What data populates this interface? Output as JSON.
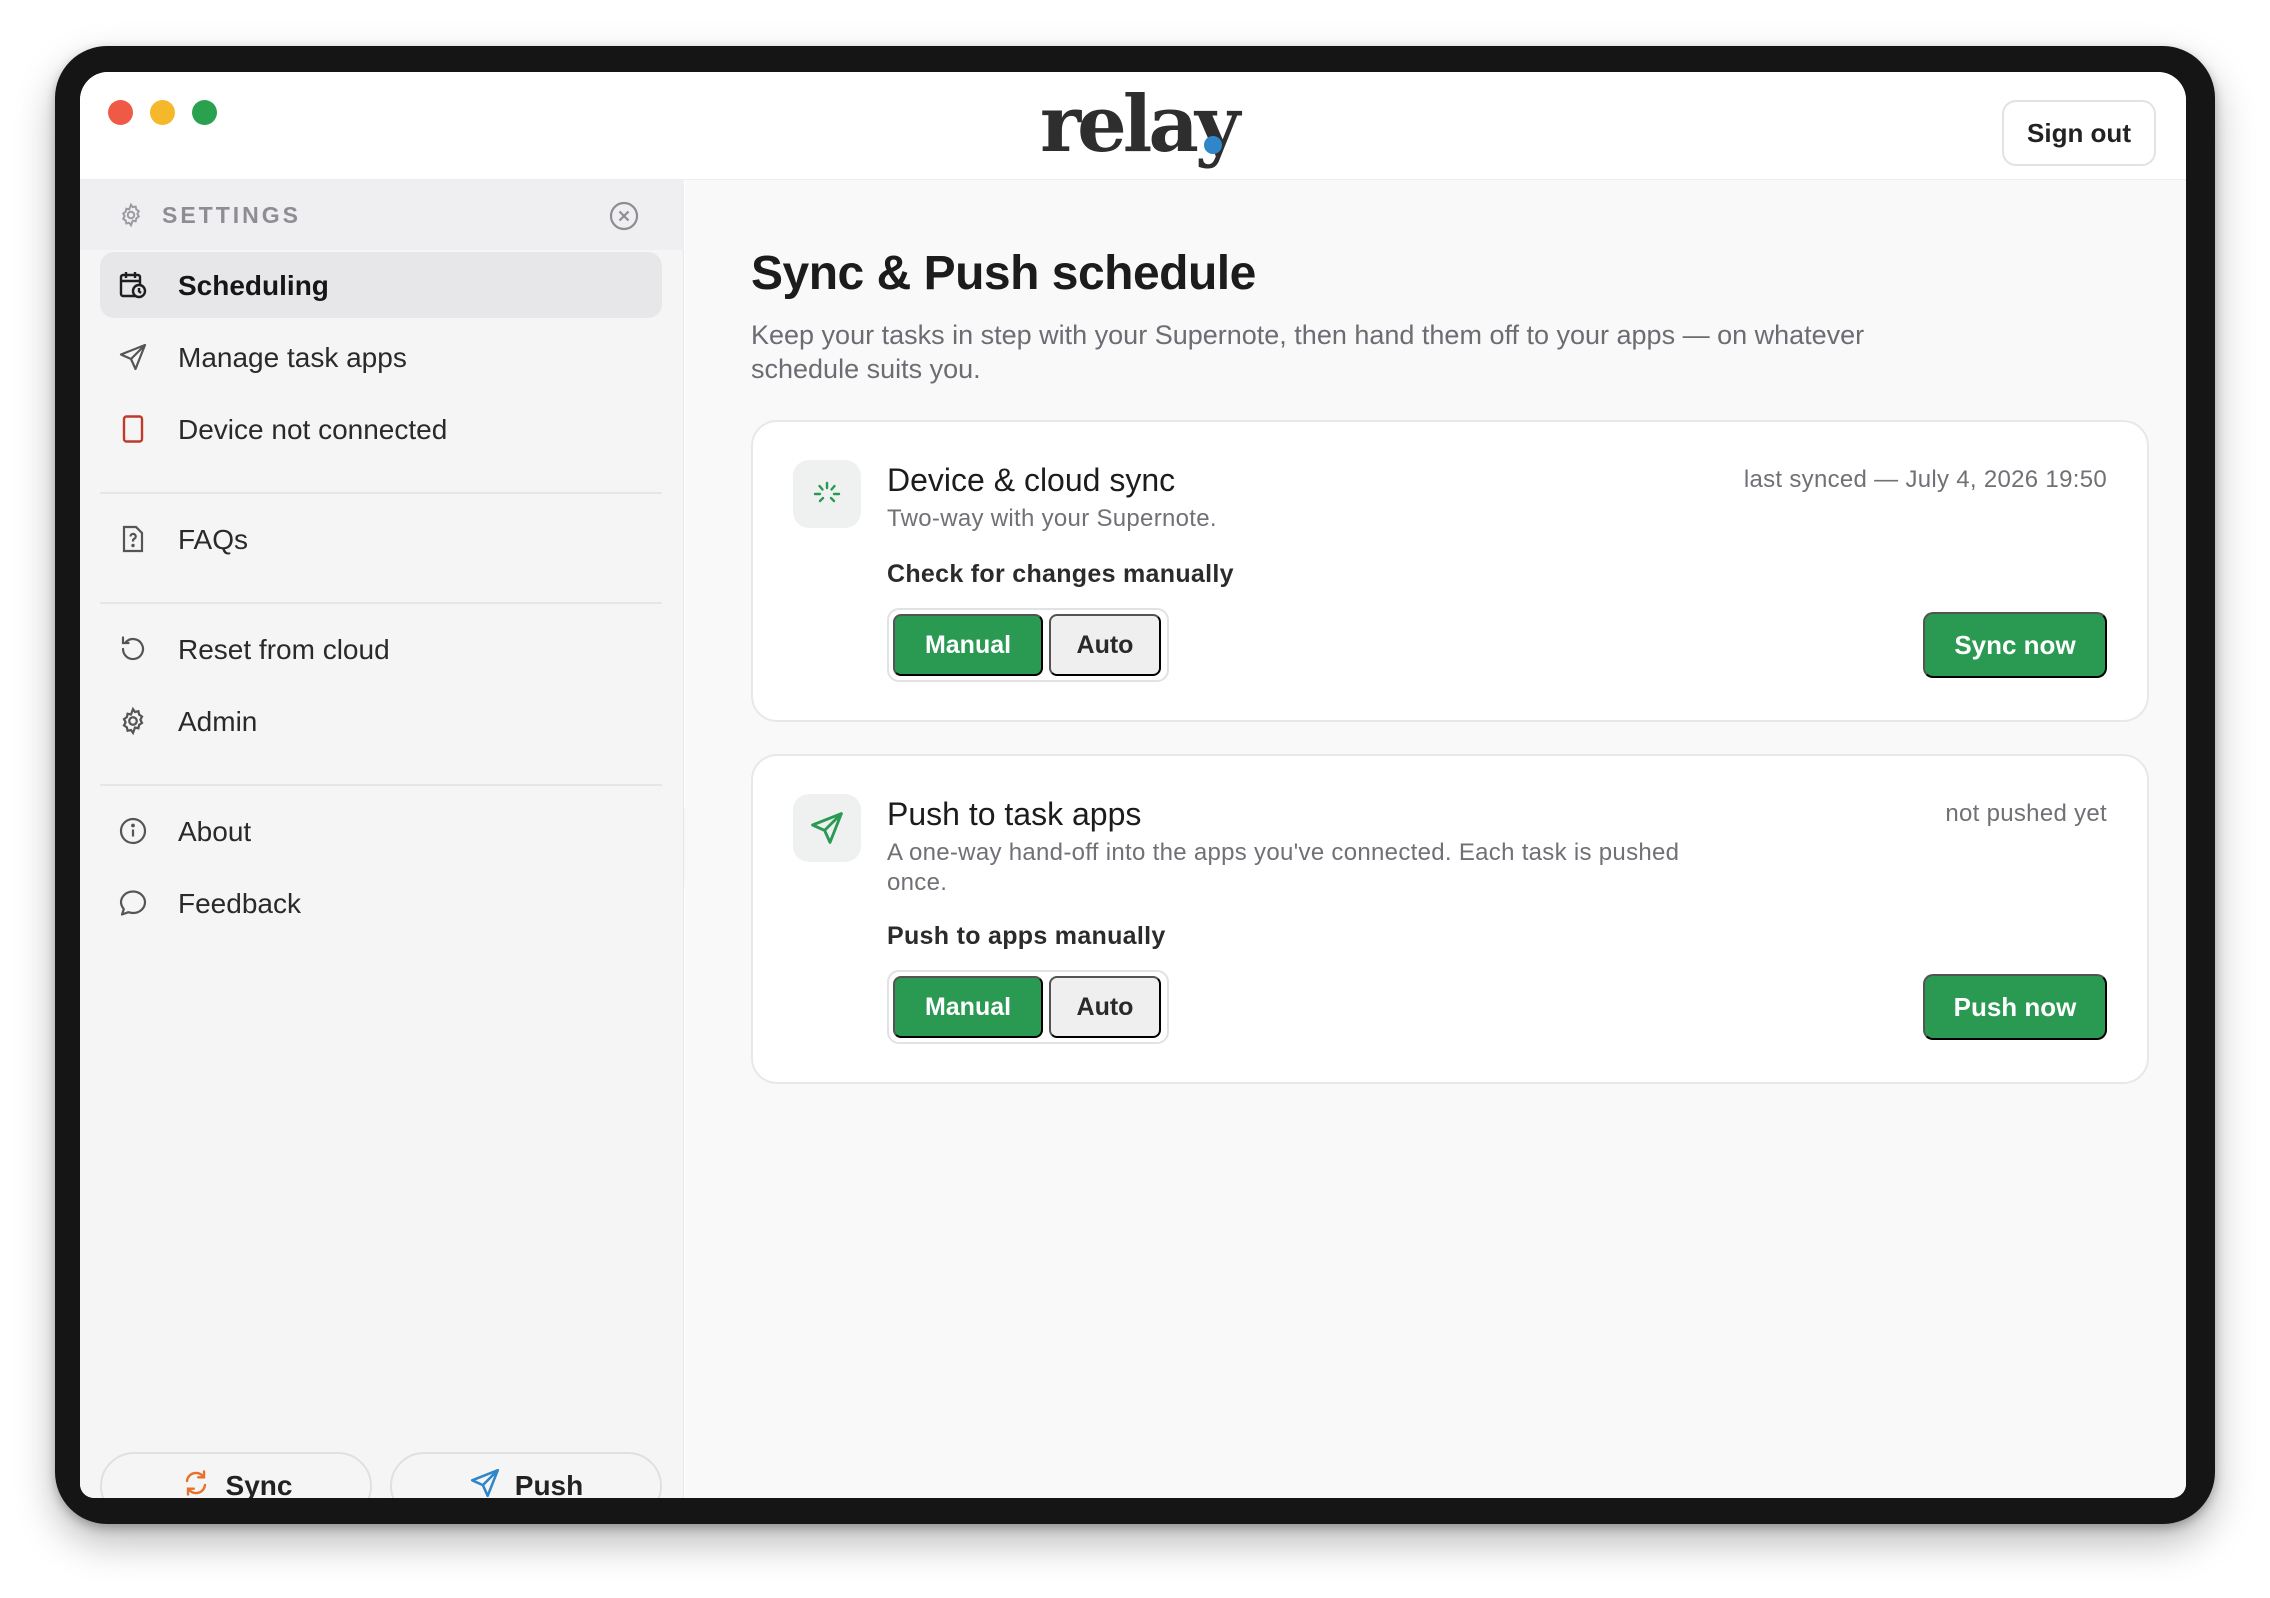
{
  "app": {
    "logo": "relay",
    "sign_out": "Sign out"
  },
  "sidebar": {
    "title": "SETTINGS",
    "items": [
      {
        "label": "Scheduling",
        "icon": "calendar-clock-icon",
        "active": true
      },
      {
        "label": "Manage task apps",
        "icon": "send-icon"
      },
      {
        "label": "Device not connected",
        "icon": "tablet-icon",
        "status_color": "#c0392b"
      },
      {
        "label": "FAQs",
        "icon": "question-doc-icon"
      },
      {
        "label": "Reset from cloud",
        "icon": "rotate-ccw-icon"
      },
      {
        "label": "Admin",
        "icon": "gear-icon"
      },
      {
        "label": "About",
        "icon": "info-icon"
      },
      {
        "label": "Feedback",
        "icon": "chat-bubble-icon"
      }
    ],
    "bottom": {
      "sync_label": "Sync",
      "push_label": "Push"
    }
  },
  "main": {
    "title": "Sync & Push schedule",
    "subtitle": "Keep your tasks in step with your Supernote, then hand them off to your apps — on whatever schedule suits you.",
    "cards": [
      {
        "title": "Device & cloud sync",
        "subtitle": "Two-way with your Supernote.",
        "status": "last synced — July 4, 2026 19:50",
        "mode_label": "Check for changes manually",
        "options": [
          "Manual",
          "Auto"
        ],
        "selected": "Manual",
        "action": "Sync now"
      },
      {
        "title": "Push to task apps",
        "subtitle": "A one-way hand-off into the apps you've connected. Each task is pushed once.",
        "status": "not pushed yet",
        "mode_label": "Push to apps manually",
        "options": [
          "Manual",
          "Auto"
        ],
        "selected": "Manual",
        "action": "Push now"
      }
    ]
  },
  "colors": {
    "accent": "#2a9a53",
    "logo_dot": "#2f86c9",
    "sync_icon": "#e8702a",
    "push_icon": "#2f86c9"
  }
}
